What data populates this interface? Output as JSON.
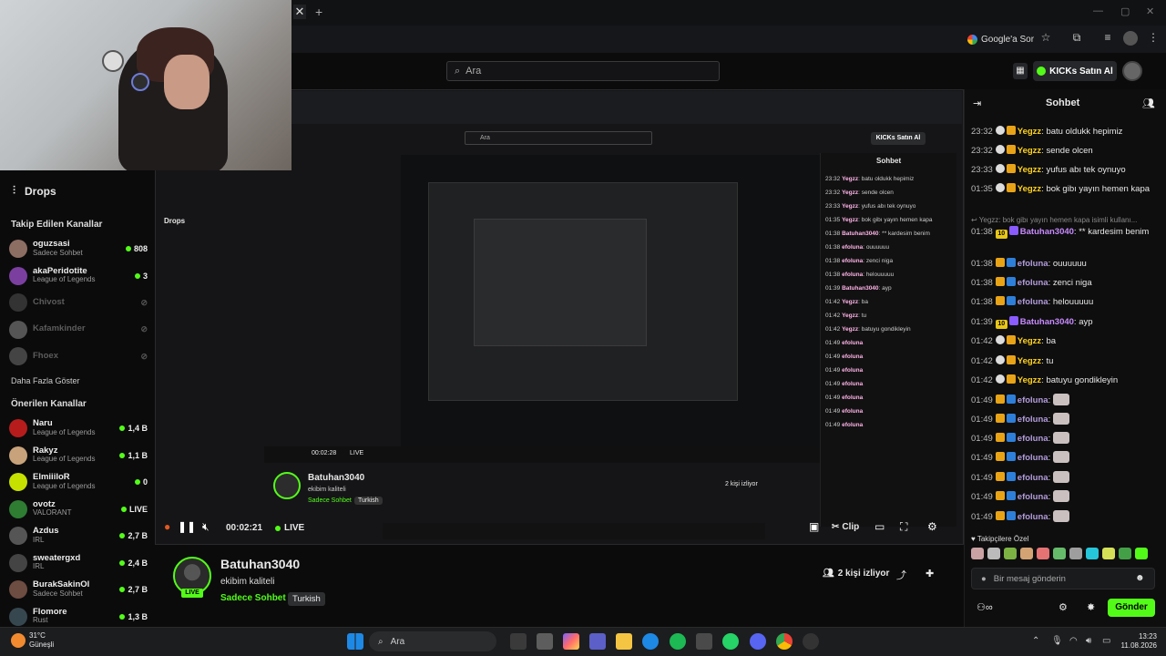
{
  "browser": {
    "close_glyph": "✕",
    "newtab_glyph": "+",
    "google_sor": "Google'a Sor"
  },
  "header": {
    "search_placeholder": "Ara",
    "kicks_button": "KICKs Satın Al",
    "accent": "#53fc18"
  },
  "sidebar": {
    "drops": "Drops",
    "followed_title": "Takip Edilen Kanallar",
    "show_more": "Daha Fazla Göster",
    "recommended_title": "Önerilen Kanallar",
    "followed": [
      {
        "name": "oguzsasi",
        "sub": "Sadece Sohbet",
        "count": "808",
        "color": "#8d6e63"
      },
      {
        "name": "akaPeridotite",
        "sub": "League of Legends",
        "count": "3",
        "color": "#7b3fa0"
      },
      {
        "name": "Chivost",
        "sub": "",
        "count": "",
        "color": "#333"
      },
      {
        "name": "Kafamkinder",
        "sub": "",
        "count": "",
        "color": "#555"
      },
      {
        "name": "Fhoex",
        "sub": "",
        "count": "",
        "color": "#444"
      }
    ],
    "recommended": [
      {
        "name": "Naru",
        "sub": "League of Legends",
        "count": "1,4 B",
        "color": "#b71c1c"
      },
      {
        "name": "Rakyz",
        "sub": "League of Legends",
        "count": "1,1 B",
        "color": "#c8a27a"
      },
      {
        "name": "ElmiiiloR",
        "sub": "League of Legends",
        "count": "0",
        "color": "#c6e000"
      },
      {
        "name": "ovotz",
        "sub": "VALORANT",
        "count": "LIVE",
        "color": "#2e7d32"
      },
      {
        "name": "Azdus",
        "sub": "IRL",
        "count": "2,7 B",
        "color": "#555"
      },
      {
        "name": "sweatergxd",
        "sub": "IRL",
        "count": "2,4 B",
        "color": "#444"
      },
      {
        "name": "BurakSakinOl",
        "sub": "Sadece Sohbet",
        "count": "2,7 B",
        "color": "#6d4c41"
      },
      {
        "name": "Flomore",
        "sub": "Rust",
        "count": "1,3 B",
        "color": "#37474f"
      }
    ]
  },
  "player": {
    "timecode": "00:02:21",
    "live": "LIVE",
    "clip": "Clip"
  },
  "channel": {
    "name": "Batuhan3040",
    "title": "ekibim kaliteli",
    "category": "Sadece Sohbet",
    "language": "Turkish",
    "viewers": "2 kişi izliyor",
    "live_badge": "LIVE"
  },
  "nested": {
    "search": "Ara",
    "kicks": "KICKs Satın Al",
    "drops": "Drops",
    "name": "Batuhan3040",
    "title": "ekibim kaliteli",
    "category": "Sadece Sohbet",
    "language": "Turkish",
    "viewers": "2 kişi izliyor",
    "timecode": "00:02:28",
    "live": "LIVE",
    "chat_title": "Sohbet"
  },
  "chat": {
    "title": "Sohbet",
    "reply_preview": "↩ Yegzz: bok gibı yayın hemen kapa isimli kullanı...",
    "messages": [
      {
        "t": "23:32",
        "b": "og",
        "u": "Yegzz",
        "c": "y",
        "m": "batu oldukk hepimiz"
      },
      {
        "t": "23:32",
        "b": "og",
        "u": "Yegzz",
        "c": "y",
        "m": "sende olcen"
      },
      {
        "t": "23:33",
        "b": "og",
        "u": "Yegzz",
        "c": "y",
        "m": "yufus abı tek oynuyo"
      },
      {
        "t": "01:35",
        "b": "og",
        "u": "Yegzz",
        "c": "y",
        "m": "bok gibı yayın hemen kapa"
      },
      {
        "t": "01:38",
        "b": "10",
        "u": "Batuhan3040",
        "c": "b",
        "m": "** kardesim benim"
      },
      {
        "t": "01:38",
        "b": "crown",
        "u": "efoluna",
        "c": "e",
        "m": "ouuuuuu"
      },
      {
        "t": "01:38",
        "b": "crown",
        "u": "efoluna",
        "c": "e",
        "m": "zenci niga"
      },
      {
        "t": "01:38",
        "b": "crown",
        "u": "efoluna",
        "c": "e",
        "m": "helouuuuu"
      },
      {
        "t": "01:39",
        "b": "10",
        "u": "Batuhan3040",
        "c": "b",
        "m": "ayp"
      },
      {
        "t": "01:42",
        "b": "og",
        "u": "Yegzz",
        "c": "y",
        "m": "ba"
      },
      {
        "t": "01:42",
        "b": "og",
        "u": "Yegzz",
        "c": "y",
        "m": "tu"
      },
      {
        "t": "01:42",
        "b": "og",
        "u": "Yegzz",
        "c": "y",
        "m": "batuyu gondikleyin"
      },
      {
        "t": "01:49",
        "b": "crown",
        "u": "efoluna",
        "c": "e",
        "m": ""
      },
      {
        "t": "01:49",
        "b": "crown",
        "u": "efoluna",
        "c": "e",
        "m": ""
      },
      {
        "t": "01:49",
        "b": "crown",
        "u": "efoluna",
        "c": "e",
        "m": ""
      },
      {
        "t": "01:49",
        "b": "crown",
        "u": "efoluna",
        "c": "e",
        "m": ""
      },
      {
        "t": "01:49",
        "b": "crown",
        "u": "efoluna",
        "c": "e",
        "m": ""
      },
      {
        "t": "01:49",
        "b": "crown",
        "u": "efoluna",
        "c": "e",
        "m": ""
      },
      {
        "t": "01:49",
        "b": "crown",
        "u": "efoluna",
        "c": "e",
        "m": ""
      }
    ],
    "emotes_label": "♥ Takipçilere Özel",
    "input_placeholder": "Bir mesaj gönderin",
    "send": "Gönder"
  },
  "taskbar": {
    "temp": "31°C",
    "weather": "Güneşli",
    "search": "Ara",
    "time": "13:23",
    "date": "11.08.2026"
  }
}
